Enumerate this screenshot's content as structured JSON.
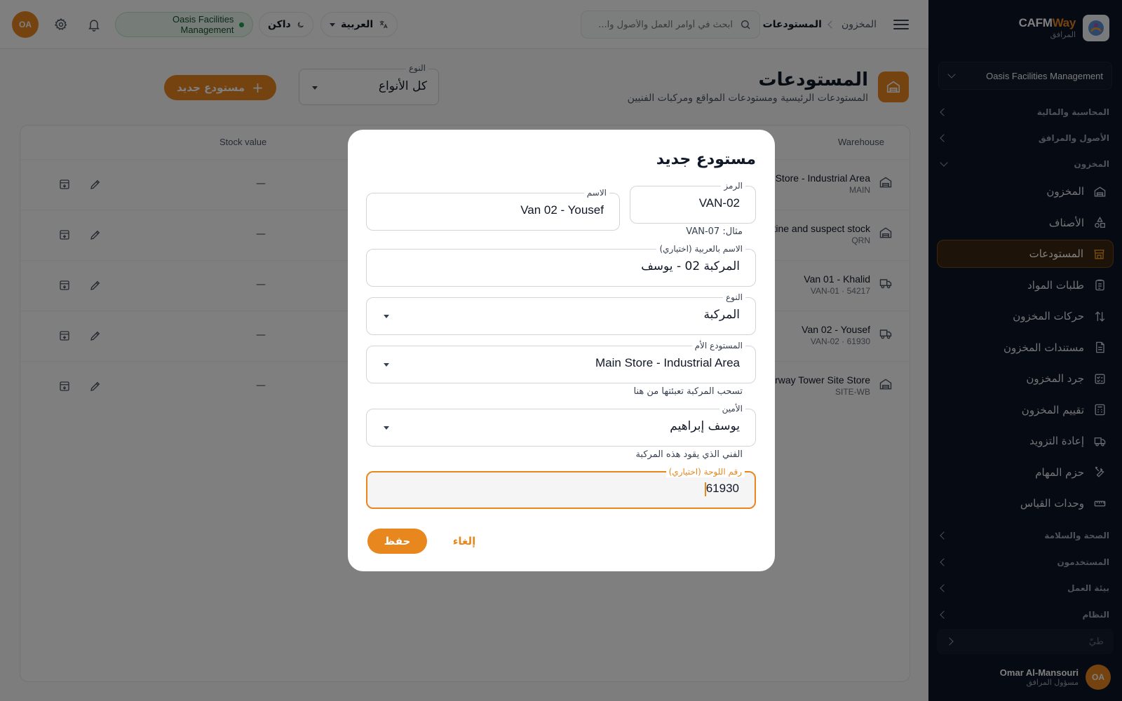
{
  "brand": {
    "name_part1": "CAFM",
    "name_part2": "Way",
    "subtitle": "المرافق"
  },
  "sidebar": {
    "org_selector": "Oasis Facilities Management",
    "sections": [
      {
        "label": "المحاسبة والمالية",
        "expanded": false
      },
      {
        "label": "الأصول والمرافق",
        "expanded": false
      },
      {
        "label": "المخزون",
        "expanded": true
      }
    ],
    "inventory_items": [
      {
        "label": "المخزون",
        "icon": "warehouse-icon",
        "active": false
      },
      {
        "label": "الأصناف",
        "icon": "shapes-icon",
        "active": false
      },
      {
        "label": "المستودعات",
        "icon": "store-icon",
        "active": true
      },
      {
        "label": "طلبات المواد",
        "icon": "clipboard-icon",
        "active": false
      },
      {
        "label": "حركات المخزون",
        "icon": "arrows-icon",
        "active": false
      },
      {
        "label": "مستندات المخزون",
        "icon": "document-icon",
        "active": false
      },
      {
        "label": "جرد المخزون",
        "icon": "checklist-icon",
        "active": false
      },
      {
        "label": "تقييم المخزون",
        "icon": "calculator-icon",
        "active": false
      },
      {
        "label": "إعادة التزويد",
        "icon": "truck-icon",
        "active": false
      },
      {
        "label": "حزم المهام",
        "icon": "tools-icon",
        "active": false
      },
      {
        "label": "وحدات القياس",
        "icon": "ruler-icon",
        "active": false
      }
    ],
    "bottom_sections": [
      {
        "label": "الصحة والسلامة"
      },
      {
        "label": "المستخدمون"
      },
      {
        "label": "بيئة العمل"
      },
      {
        "label": "النظام"
      }
    ],
    "collapse_label": "طيّ",
    "user": {
      "initials": "OA",
      "name": "Omar Al-Mansouri",
      "role": "مسؤول المرافق"
    }
  },
  "topbar": {
    "breadcrumb": [
      "المخزون",
      "المستودعات"
    ],
    "search_placeholder": "ابحث في أوامر العمل والأصول وا...",
    "language": "العربية",
    "theme": "داكن",
    "org": "Oasis Facilities Management",
    "avatar_initials": "OA"
  },
  "page": {
    "title": "المستودعات",
    "subtitle": "المستودعات الرئيسية ومستودعات المواقع ومركبات الفنيين",
    "type_filter_label": "النوع",
    "type_filter_value": "كل الأنواع",
    "new_button": "مستودع جديد"
  },
  "table": {
    "headers": {
      "warehouse": "Warehouse",
      "stock_value": "Stock value"
    },
    "rows": [
      {
        "name": "Main Store - Industrial Area",
        "code": "MAIN",
        "type_icon": "warehouse-icon",
        "stock_value": "—"
      },
      {
        "name": "Quarantine and suspect stock",
        "code": "QRN",
        "type_icon": "warehouse-icon",
        "stock_value": "—"
      },
      {
        "name": "Van 01 - Khalid",
        "code": "VAN-01 · 54217",
        "type_icon": "truck-icon",
        "stock_value": "—"
      },
      {
        "name": "Van 02 - Yousef",
        "code": "VAN-02 · 61930",
        "type_icon": "truck-icon",
        "stock_value": "—"
      },
      {
        "name": "Waterway Tower Site Store",
        "code": "SITE-WB",
        "type_icon": "warehouse-icon",
        "stock_value": "—"
      }
    ]
  },
  "modal": {
    "title": "مستودع جديد",
    "code": {
      "label": "الرمز",
      "value": "VAN-02",
      "hint": "مثال: VAN-07"
    },
    "name": {
      "label": "الاسم",
      "value": "Van 02 - Yousef"
    },
    "arabic_name": {
      "label": "الاسم بالعربية (اختياري)",
      "value": "المركبة 02 - يوسف"
    },
    "type": {
      "label": "النوع",
      "value": "المركبة"
    },
    "parent": {
      "label": "المستودع الأم",
      "value": "Main Store - Industrial Area",
      "hint": "تسحب المركبة تعبئتها من هنا"
    },
    "keeper": {
      "label": "الأمين",
      "value": "يوسف إبراهيم",
      "hint": "الفني الذي يقود هذه المركبة"
    },
    "plate": {
      "label": "رقم اللوحة (اختياري)",
      "value": "61930"
    },
    "save_label": "حفظ",
    "cancel_label": "إلغاء"
  },
  "colors": {
    "accent": "#e8871e",
    "sidebar_bg": "#0d1524",
    "org_badge_bg": "#ecf8ef",
    "status_dot": "#22a04a"
  }
}
